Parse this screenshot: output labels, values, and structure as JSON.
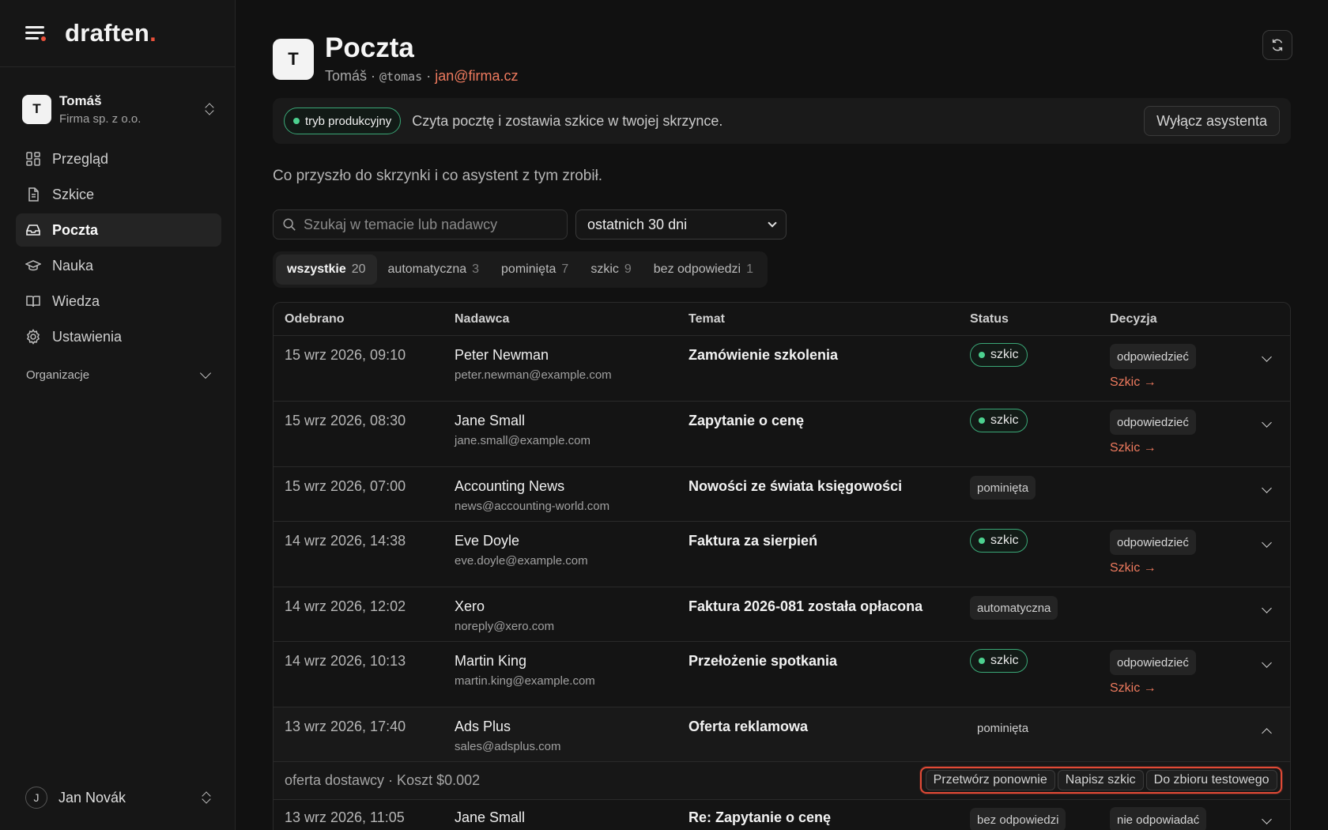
{
  "brand": {
    "name": "draften",
    "dot": "."
  },
  "org": {
    "initial": "T",
    "name": "Tomáš",
    "company": "Firma sp. z o.o."
  },
  "nav": {
    "items": [
      {
        "label": "Przegląd",
        "icon": "dashboard-icon"
      },
      {
        "label": "Szkice",
        "icon": "document-icon"
      },
      {
        "label": "Poczta",
        "icon": "inbox-icon",
        "active": true
      },
      {
        "label": "Nauka",
        "icon": "graduation-cap-icon"
      },
      {
        "label": "Wiedza",
        "icon": "book-icon"
      },
      {
        "label": "Ustawienia",
        "icon": "gear-icon"
      }
    ],
    "section": "Organizacje"
  },
  "user": {
    "initial": "J",
    "name": "Jan Novák"
  },
  "header": {
    "initial": "T",
    "title": "Poczta",
    "name": "Tomáš",
    "sep1": " · ",
    "handle": "@tomas",
    "sep2": " · ",
    "email": "jan@firma.cz"
  },
  "banner": {
    "badge": "tryb produkcyjny",
    "text": "Czyta pocztę i zostawia szkice w twojej skrzynce.",
    "button": "Wyłącz asystenta"
  },
  "description": "Co przyszło do skrzynki i co asystent z tym zrobił.",
  "search": {
    "placeholder": "Szukaj w temacie lub nadawcy"
  },
  "range": {
    "selected": "ostatnich 30 dni"
  },
  "filters": [
    {
      "label": "wszystkie",
      "count": "20",
      "active": true
    },
    {
      "label": "automatyczna",
      "count": "3"
    },
    {
      "label": "pominięta",
      "count": "7"
    },
    {
      "label": "szkic",
      "count": "9"
    },
    {
      "label": "bez odpowiedzi",
      "count": "1"
    }
  ],
  "table": {
    "headers": {
      "date": "Odebrano",
      "from": "Nadawca",
      "subject": "Temat",
      "status": "Status",
      "decision": "Decyzja"
    },
    "rows": [
      {
        "date": "15 wrz 2026, 09:10",
        "name": "Peter Newman",
        "email": "peter.newman@example.com",
        "subject": "Zamówienie szkolenia",
        "status": "szkic",
        "decision": "odpowiedzieć",
        "link": "Szkic →"
      },
      {
        "date": "15 wrz 2026, 08:30",
        "name": "Jane Small",
        "email": "jane.small@example.com",
        "subject": "Zapytanie o cenę",
        "status": "szkic",
        "decision": "odpowiedzieć",
        "link": "Szkic →"
      },
      {
        "date": "15 wrz 2026, 07:00",
        "name": "Accounting News",
        "email": "news@accounting-world.com",
        "subject": "Nowości ze świata księgowości",
        "status": "pominięta"
      },
      {
        "date": "14 wrz 2026, 14:38",
        "name": "Eve Doyle",
        "email": "eve.doyle@example.com",
        "subject": "Faktura za sierpień",
        "status": "szkic",
        "decision": "odpowiedzieć",
        "link": "Szkic →"
      },
      {
        "date": "14 wrz 2026, 12:02",
        "name": "Xero",
        "email": "noreply@xero.com",
        "subject": "Faktura 2026-081 została opłacona",
        "status": "automatyczna"
      },
      {
        "date": "14 wrz 2026, 10:13",
        "name": "Martin King",
        "email": "martin.king@example.com",
        "subject": "Przełożenie spotkania",
        "status": "szkic",
        "decision": "odpowiedzieć",
        "link": "Szkic →"
      },
      {
        "date": "13 wrz 2026, 17:40",
        "name": "Ads Plus",
        "email": "sales@adsplus.com",
        "subject": "Oferta reklamowa",
        "status": "pominięta",
        "expanded": true
      },
      {
        "date": "13 wrz 2026, 11:05",
        "name": "Jane Small",
        "email": "",
        "subject": "Re: Zapytanie o cenę",
        "status": "bez odpowiedzi",
        "decision": "nie odpowiadać"
      }
    ],
    "expanded_detail": {
      "text": "oferta dostawcy · Koszt $0.002",
      "actions": [
        "Przetwórz ponownie",
        "Napisz szkic",
        "Do zbioru testowego"
      ]
    }
  },
  "colors": {
    "accent": "#e8503a",
    "link": "#ee7a5e",
    "green": "#4cd18f",
    "highlight": "#e14a36"
  }
}
